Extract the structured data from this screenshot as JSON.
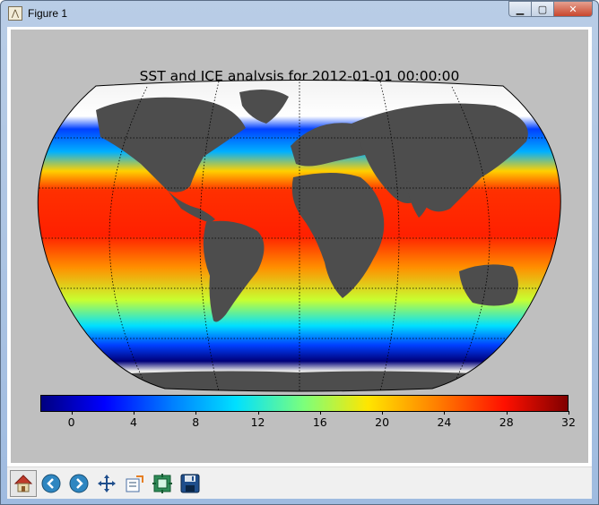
{
  "window": {
    "title": "Figure 1",
    "app_icon": "matplotlib-icon",
    "controls": [
      "minimize-icon",
      "maximize-icon",
      "close-icon"
    ]
  },
  "figure": {
    "title": "SST and ICE analysis for 2012-01-01 00:00:00",
    "background": "#bfbfbf",
    "land_color": "#4d4d4d"
  },
  "chart_data": {
    "type": "heatmap",
    "title": "SST and ICE analysis for 2012-01-01 00:00:00",
    "projection": "kav7",
    "grid": true,
    "colorbar": {
      "orientation": "horizontal",
      "placement": "bottom",
      "colormap": "jet",
      "range": [
        -2,
        32
      ],
      "ticks": [
        0,
        4,
        8,
        12,
        16,
        20,
        24,
        28,
        32
      ],
      "tick_labels": [
        "0",
        "4",
        "8",
        "12",
        "16",
        "20",
        "24",
        "28",
        "32"
      ]
    }
  },
  "toolbar": {
    "buttons": [
      {
        "name": "home-icon",
        "glyph": "home"
      },
      {
        "name": "back-icon",
        "glyph": "back"
      },
      {
        "name": "forward-icon",
        "glyph": "forward"
      },
      {
        "name": "pan-icon",
        "glyph": "pan"
      },
      {
        "name": "zoom-icon",
        "glyph": "zoom"
      },
      {
        "name": "subplots-icon",
        "glyph": "subplots"
      },
      {
        "name": "save-icon",
        "glyph": "save"
      }
    ]
  }
}
